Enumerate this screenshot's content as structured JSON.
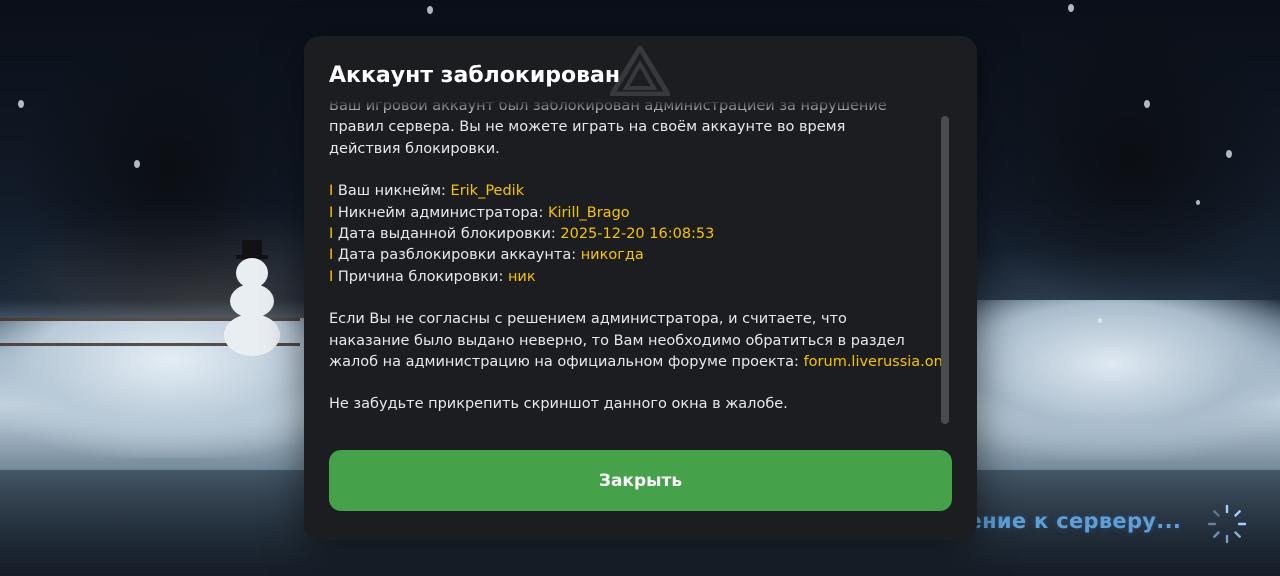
{
  "modal": {
    "title": "Аккаунт заблокирован",
    "intro_lines": [
      "Ваш игровой аккаунт был заблокирован администрацией за нарушение",
      "правил сервера. Вы не можете играть на своём аккаунте во время",
      "действия блокировки."
    ],
    "bullet_char": "I",
    "details": [
      {
        "label": "Ваш никнейм: ",
        "value": "Erik_Pedik"
      },
      {
        "label": "Никнейм администратора: ",
        "value": "Kirill_Brago"
      },
      {
        "label": "Дата выданной блокировки: ",
        "value": "2025-12-20 16:08:53"
      },
      {
        "label": "Дата разблокировки аккаунта: ",
        "value": "никогда"
      },
      {
        "label": "Причина блокировки: ",
        "value": "ник"
      }
    ],
    "appeal_lines": [
      "Если Вы не согласны с решением администратора, и считаете, что",
      "наказание было выдано неверно, то Вам необходимо обратиться в раздел",
      "жалоб на администрацию на официальном форуме проекта: "
    ],
    "forum_link": "forum.liverussia.online",
    "reminder": "Не забудьте прикрепить скриншот данного окна в жалобе.",
    "close_label": "Закрыть"
  },
  "background": {
    "status_text": "Подключение к серверу..."
  },
  "colors": {
    "accent_yellow": "#f5c400",
    "button_green": "#45a24a",
    "modal_bg": "#1c1d21",
    "status_blue": "#5f9fd6"
  }
}
